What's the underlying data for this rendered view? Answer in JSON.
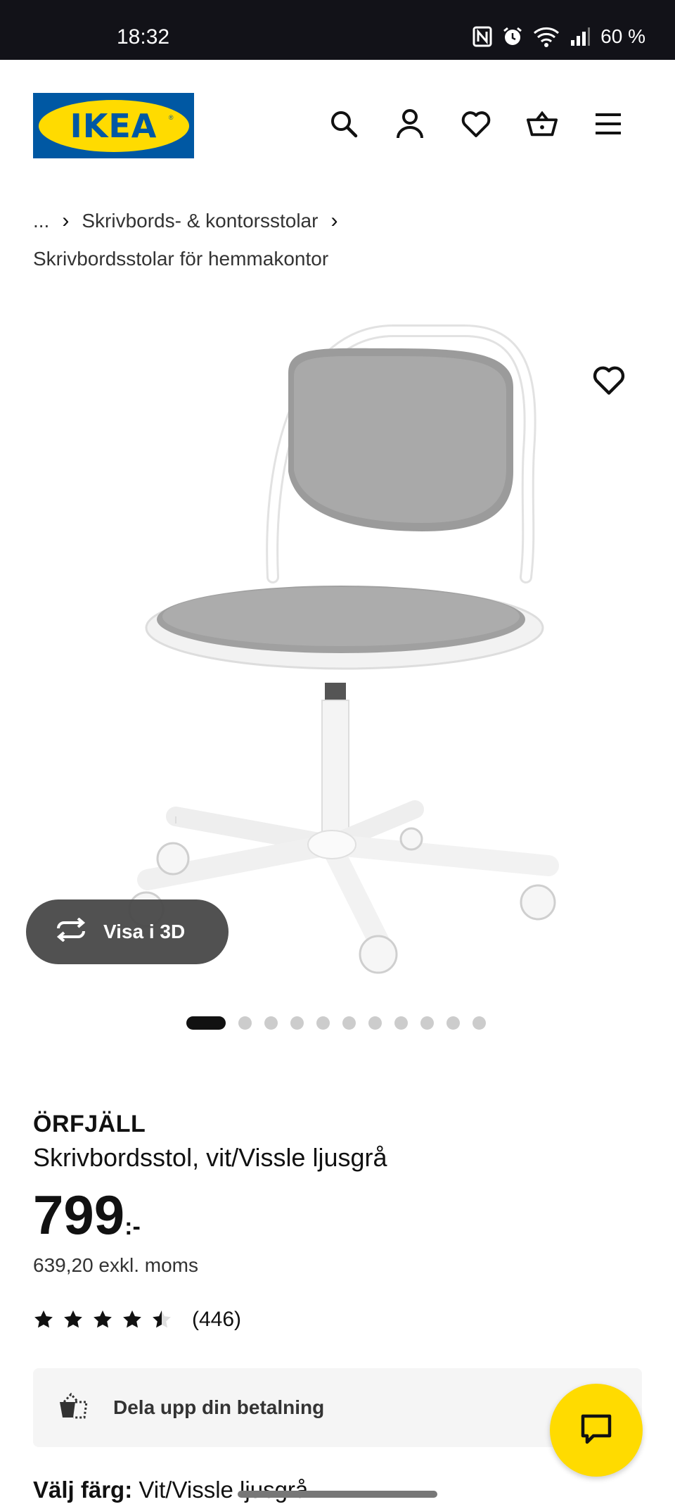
{
  "status_bar": {
    "time": "18:32",
    "battery": "60 %"
  },
  "header": {
    "logo_text": "IKEA",
    "logo_reg": "®"
  },
  "breadcrumb": {
    "ellipsis": "...",
    "separator": "›",
    "level1": "Skrivbords- & kontorsstolar",
    "level2": "Skrivbordsstolar för hemmakontor"
  },
  "gallery": {
    "view_3d_label": "Visa i 3D",
    "dot_count": 11,
    "active_index": 0
  },
  "product": {
    "name": "ÖRFJÄLL",
    "description": "Skrivbordsstol, vit/Vissle ljusgrå",
    "price": "799",
    "price_suffix": ":-",
    "price_ex_vat": "639,20 exkl. moms",
    "rating": 4.5,
    "review_count": "(446)"
  },
  "payment": {
    "label": "Dela upp din betalning"
  },
  "color": {
    "label": "Välj färg:",
    "value": "Vit/Vissle ljusgrå"
  },
  "colors": {
    "brand_blue": "#0058a3",
    "brand_yellow": "#ffdb00"
  }
}
